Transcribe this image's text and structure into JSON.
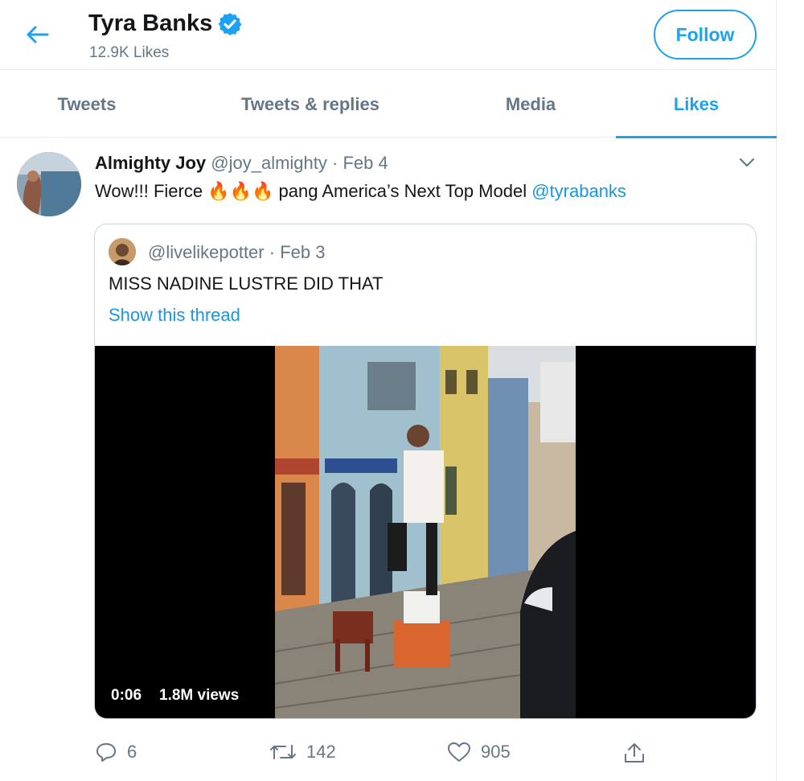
{
  "header": {
    "name": "Tyra Banks",
    "subtitle": "12.9K Likes",
    "follow_label": "Follow"
  },
  "tabs": [
    {
      "label": "Tweets",
      "active": false
    },
    {
      "label": "Tweets & replies",
      "active": false
    },
    {
      "label": "Media",
      "active": false
    },
    {
      "label": "Likes",
      "active": true
    }
  ],
  "tweet": {
    "author_name": "Almighty Joy",
    "author_handle": "@joy_almighty",
    "separator": "·",
    "date": "Feb 4",
    "text_before": "Wow!!! Fierce",
    "emojis": "🔥🔥🔥",
    "text_after": "pang America’s Next Top Model",
    "mention": "@tyrabanks",
    "quote": {
      "handle": "@livelikepotter",
      "separator": "·",
      "date": "Feb 3",
      "text": "MISS NADINE LUSTRE DID THAT",
      "thread_link": "Show this thread",
      "video": {
        "duration": "0:06",
        "views": "1.8M views"
      }
    },
    "actions": {
      "replies": "6",
      "retweets": "142",
      "likes": "905"
    }
  },
  "colors": {
    "accent": "#1da1f2",
    "link": "#1b95e0",
    "secondary_text": "#657786",
    "border": "#e6ecf0"
  },
  "icons": [
    "back-arrow-icon",
    "verified-badge-icon",
    "chevron-down-icon",
    "reply-icon",
    "retweet-icon",
    "like-icon",
    "share-icon"
  ]
}
